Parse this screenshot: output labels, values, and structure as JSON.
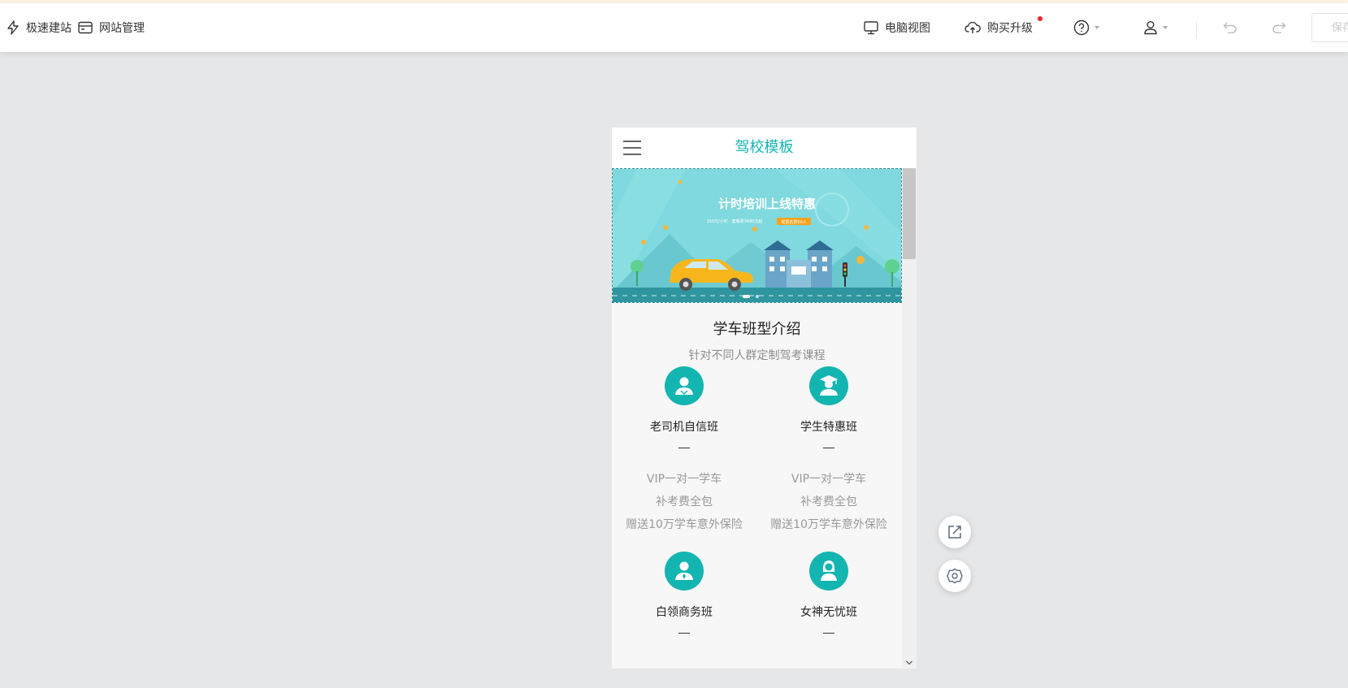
{
  "toolbar": {
    "quick_build": "极速建站",
    "site_manage": "网站管理",
    "pc_view": "电脑视图",
    "buy_upgrade": "购买升级",
    "save": "保存"
  },
  "phone": {
    "title": "驾校模板",
    "banner": {
      "headline": "计时培训上线特惠",
      "subline": "150元/小时 · 套餐费3480元起",
      "tag": "现报名限60人"
    },
    "section": {
      "title": "学车班型介绍",
      "subtitle": "针对不同人群定制驾考课程"
    },
    "classes": [
      {
        "name": "老司机自信班",
        "dash": "—",
        "lines": [
          "VIP一对一学车",
          "补考费全包",
          "赠送10万学车意外保险"
        ],
        "icon": "driver-icon"
      },
      {
        "name": "学生特惠班",
        "dash": "—",
        "lines": [
          "VIP一对一学车",
          "补考费全包",
          "赠送10万学车意外保险"
        ],
        "icon": "graduate-icon"
      },
      {
        "name": "白领商务班",
        "dash": "—",
        "icon": "business-person-icon"
      },
      {
        "name": "女神无忧班",
        "dash": "—",
        "icon": "woman-icon"
      }
    ]
  },
  "colors": {
    "accent": "#13b5b1",
    "background": "#e6e7e9",
    "badge": "#f5222d"
  }
}
